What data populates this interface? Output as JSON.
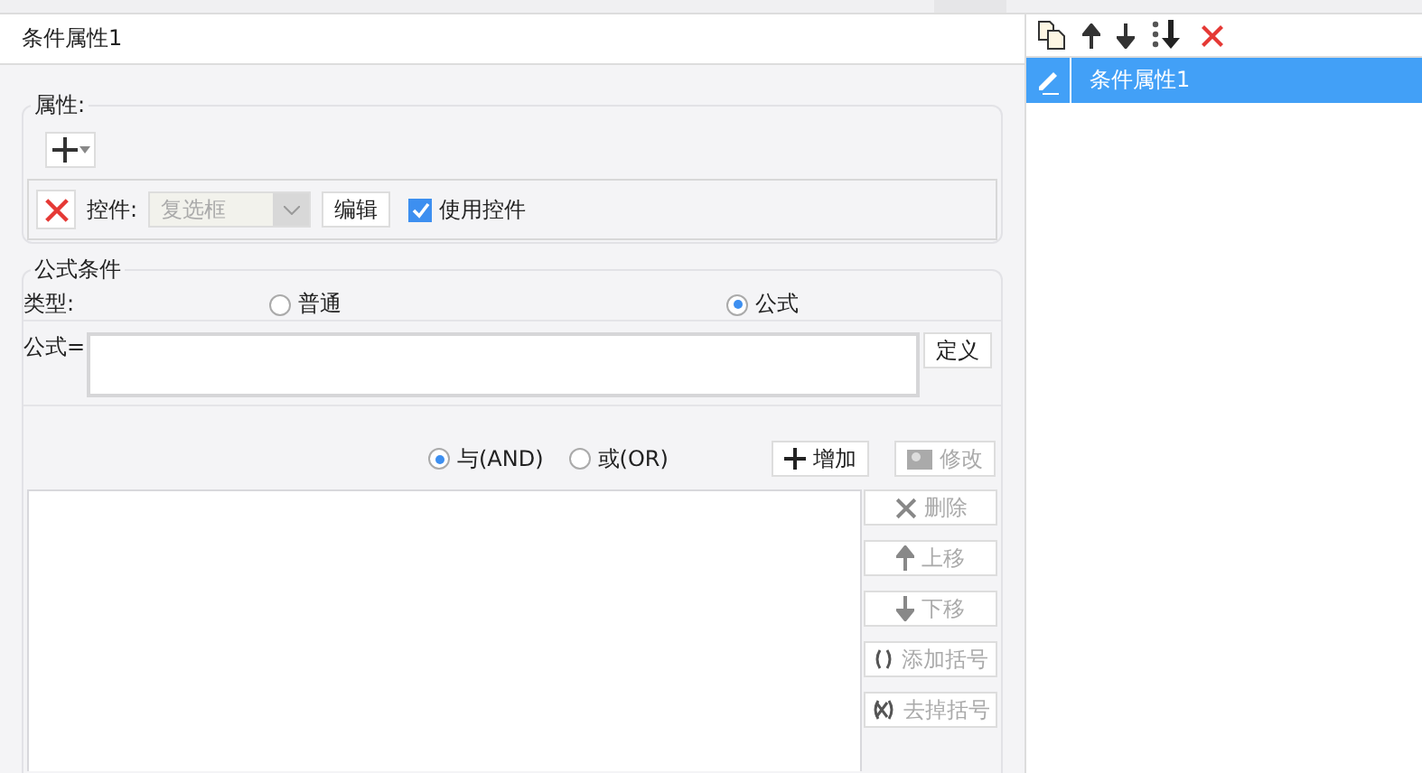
{
  "header": {
    "title": "条件属性1"
  },
  "properties": {
    "legend": "属性:",
    "control_label": "控件:",
    "dropdown": {
      "value": "复选框",
      "disabled": true
    },
    "edit_button": "编辑",
    "use_control": {
      "label": "使用控件",
      "checked": true
    }
  },
  "formula_condition": {
    "legend": "公式条件",
    "type_label": "类型:",
    "type_options": [
      {
        "label": "普通",
        "selected": false
      },
      {
        "label": "公式",
        "selected": true
      }
    ],
    "formula_label": "公式=",
    "define_button": "定义",
    "logic_options": [
      {
        "label": "与(AND)",
        "selected": true
      },
      {
        "label": "或(OR)",
        "selected": false
      }
    ],
    "add_button": "增加",
    "modify_button": {
      "label": "修改",
      "disabled": true
    },
    "side_buttons": [
      {
        "kind": "delete",
        "label": "删除",
        "disabled": true
      },
      {
        "kind": "up",
        "label": "上移",
        "disabled": true
      },
      {
        "kind": "down",
        "label": "下移",
        "disabled": true
      },
      {
        "kind": "add-brackets",
        "label": "添加括号",
        "disabled": true
      },
      {
        "kind": "remove-brackets",
        "label": "去掉括号",
        "disabled": true
      }
    ]
  },
  "side_panel": {
    "items": [
      {
        "label": "条件属性1",
        "selected": true
      }
    ]
  }
}
